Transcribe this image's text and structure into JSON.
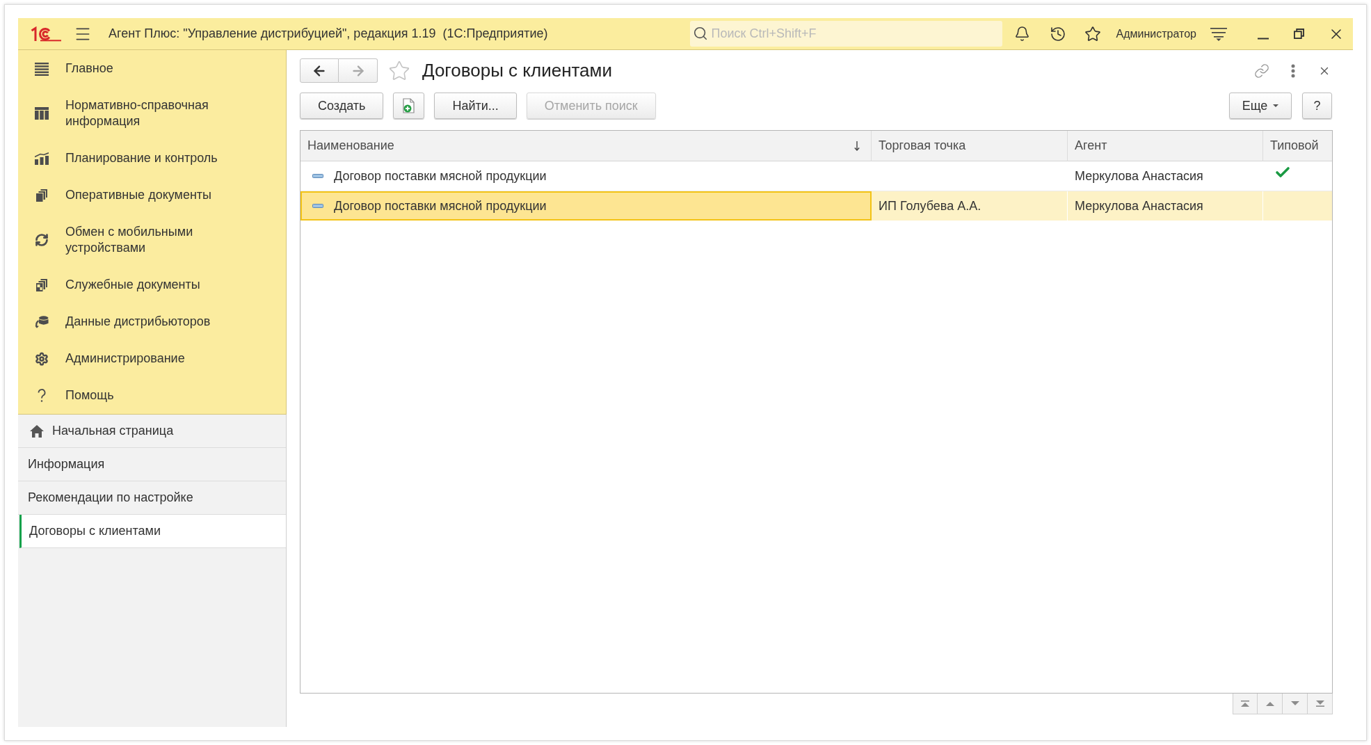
{
  "title_bar": {
    "title": "Агент Плюс: \"Управление дистрибуцией\", редакция 1.19  (1С:Предприятие)",
    "search": {
      "placeholder": "Поиск Ctrl+Shift+F"
    },
    "user": "Администратор"
  },
  "sidebar": {
    "sections": [
      {
        "label": "Главное",
        "selected": false
      },
      {
        "label": "Нормативно-справочная информация",
        "selected": false
      },
      {
        "label": "Планирование и контроль",
        "selected": false
      },
      {
        "label": "Оперативные документы",
        "selected": false
      },
      {
        "label": "Обмен с мобильными устройствами",
        "selected": false
      },
      {
        "label": "Служебные документы",
        "selected": false
      },
      {
        "label": "Данные дистрибьюторов",
        "selected": false
      },
      {
        "label": "Администрирование",
        "selected": false
      },
      {
        "label": "Помощь",
        "selected": false
      }
    ],
    "open_windows": [
      {
        "kind": "home",
        "label": "Начальная страница",
        "selected": false
      },
      {
        "kind": "form",
        "label": "Информация",
        "selected": false
      },
      {
        "kind": "form",
        "label": "Рекомендации по настройке",
        "selected": false
      },
      {
        "kind": "form",
        "label": "Договоры с клиентами",
        "selected": true
      }
    ]
  },
  "form": {
    "navigation": [
      {
        "kind": "back",
        "disabled": false
      },
      {
        "kind": "forward",
        "disabled": true
      }
    ],
    "favorite": false,
    "title": "Договоры с клиентами",
    "toolbar": [
      {
        "kind": "text",
        "label": "Создать",
        "disabled": false
      },
      {
        "kind": "icon",
        "disabled": false
      },
      {
        "kind": "text",
        "label": "Найти...",
        "disabled": false
      },
      {
        "kind": "text",
        "label": "Отменить поиск",
        "disabled": true
      }
    ],
    "toolbar_right": [
      {
        "kind": "menu",
        "label": "Еще",
        "disabled": false
      },
      {
        "kind": "text",
        "label": "?",
        "disabled": false
      }
    ]
  },
  "table": {
    "columns": [
      {
        "label": "Наименование",
        "sorted": true
      },
      {
        "label": "Торговая точка",
        "sorted": false
      },
      {
        "label": "Агент",
        "sorted": false
      },
      {
        "label": "Типовой",
        "sorted": false
      }
    ],
    "rows": [
      {
        "name": "Договор поставки мясной продукции",
        "agent": "Меркулова Анастасия",
        "typical": true,
        "selected": false
      },
      {
        "name": "Договор поставки мясной продукции",
        "trade_point": "ИП Голубева А.А.",
        "agent": "Меркулова Анастасия",
        "typical": false,
        "selected": true
      }
    ]
  }
}
